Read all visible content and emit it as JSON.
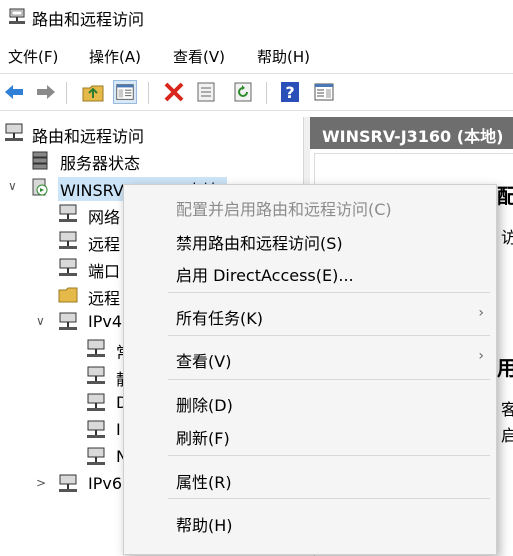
{
  "window": {
    "title": "路由和远程访问"
  },
  "menu": [
    "文件(F)",
    "操作(A)",
    "查看(V)",
    "帮助(H)"
  ],
  "toolbar": {
    "buttons": [
      "back-icon",
      "forward-icon",
      "up-folder-icon",
      "show-hide-tree-icon",
      "delete-icon",
      "properties-icon",
      "refresh-icon",
      "help-icon",
      "action-pane-icon"
    ]
  },
  "tree": {
    "root": "路由和远程访问",
    "server_status": "服务器状态",
    "server": "WINSRV-J3160 (本地)",
    "children": [
      "网络",
      "远程",
      "端口",
      "远程",
      "IPv4"
    ],
    "ipv4_children": [
      "常",
      "静",
      "D",
      "I",
      "N"
    ],
    "ipv6": "IPv6"
  },
  "right": {
    "header": "WINSRV-J3160 (本地)",
    "fragments": [
      "配",
      "访",
      "用",
      "客",
      "启"
    ]
  },
  "context_menu": {
    "items": [
      {
        "label": "配置并启用路由和远程访问(C)",
        "disabled": true
      },
      {
        "label": "禁用路由和远程访问(S)"
      },
      {
        "label": "启用 DirectAccess(E)..."
      },
      {
        "label": "所有任务(K)",
        "submenu": true
      },
      {
        "label": "查看(V)",
        "submenu": true
      },
      {
        "label": "删除(D)"
      },
      {
        "label": "刷新(F)"
      },
      {
        "label": "属性(R)"
      },
      {
        "label": "帮助(H)"
      }
    ]
  }
}
